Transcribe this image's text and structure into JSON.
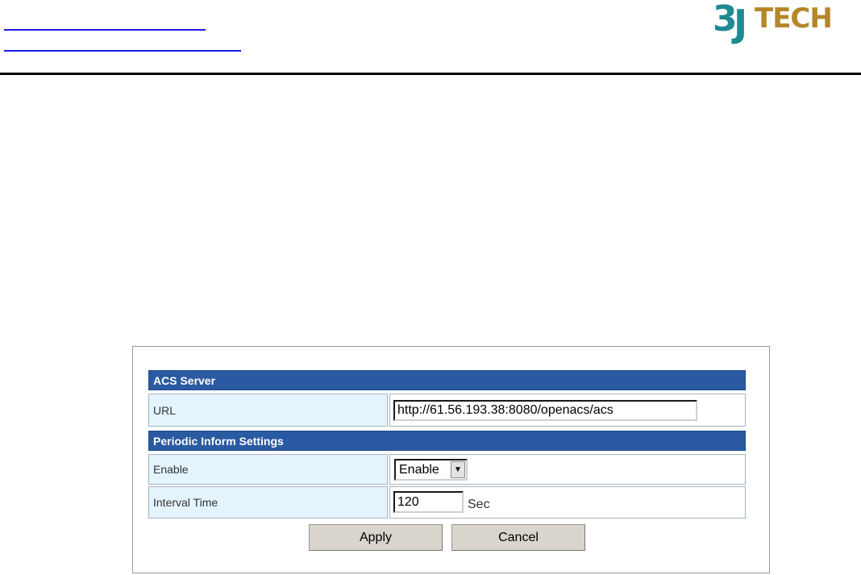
{
  "header": {
    "logo": {
      "digit": "3",
      "letter": "J",
      "word": "TECH",
      "colors": {
        "primary": "#1e8a92",
        "secondary": "#b5872a"
      }
    },
    "link_color": "#1a1aee"
  },
  "form": {
    "sections": {
      "acs_server": {
        "title": "ACS Server"
      },
      "periodic_inform": {
        "title": "Periodic Inform Settings"
      }
    },
    "fields": {
      "url": {
        "label": "URL",
        "value": "http://61.56.193.38:8080/openacs/acs"
      },
      "enable": {
        "label": "Enable",
        "selected": "Enable",
        "arrow": "▼"
      },
      "interval": {
        "label": "Interval Time",
        "value": "120",
        "unit": "Sec"
      }
    },
    "buttons": {
      "apply": "Apply",
      "cancel": "Cancel"
    },
    "colors": {
      "section_header_bg": "#2a5aa2",
      "label_cell_bg": "#e4f4fd",
      "button_bg": "#d9d5cc"
    }
  }
}
